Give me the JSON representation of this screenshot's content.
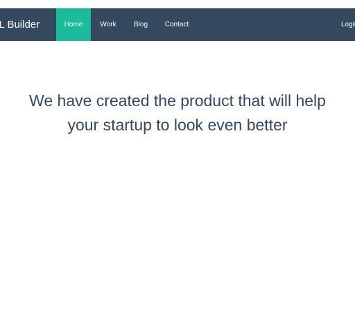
{
  "navbar": {
    "brand": "ML Builder",
    "items": [
      {
        "label": "Home",
        "active": true
      },
      {
        "label": "Work",
        "active": false
      },
      {
        "label": "Blog",
        "active": false
      },
      {
        "label": "Contact",
        "active": false
      }
    ],
    "login_label": "Login"
  },
  "hero": {
    "line1": "We have created the product that will help",
    "line2": "your startup to look even better"
  },
  "colors": {
    "navbar_bg": "#34495e",
    "active_item_bg": "#1abc9c",
    "hero_text": "#34495e"
  }
}
